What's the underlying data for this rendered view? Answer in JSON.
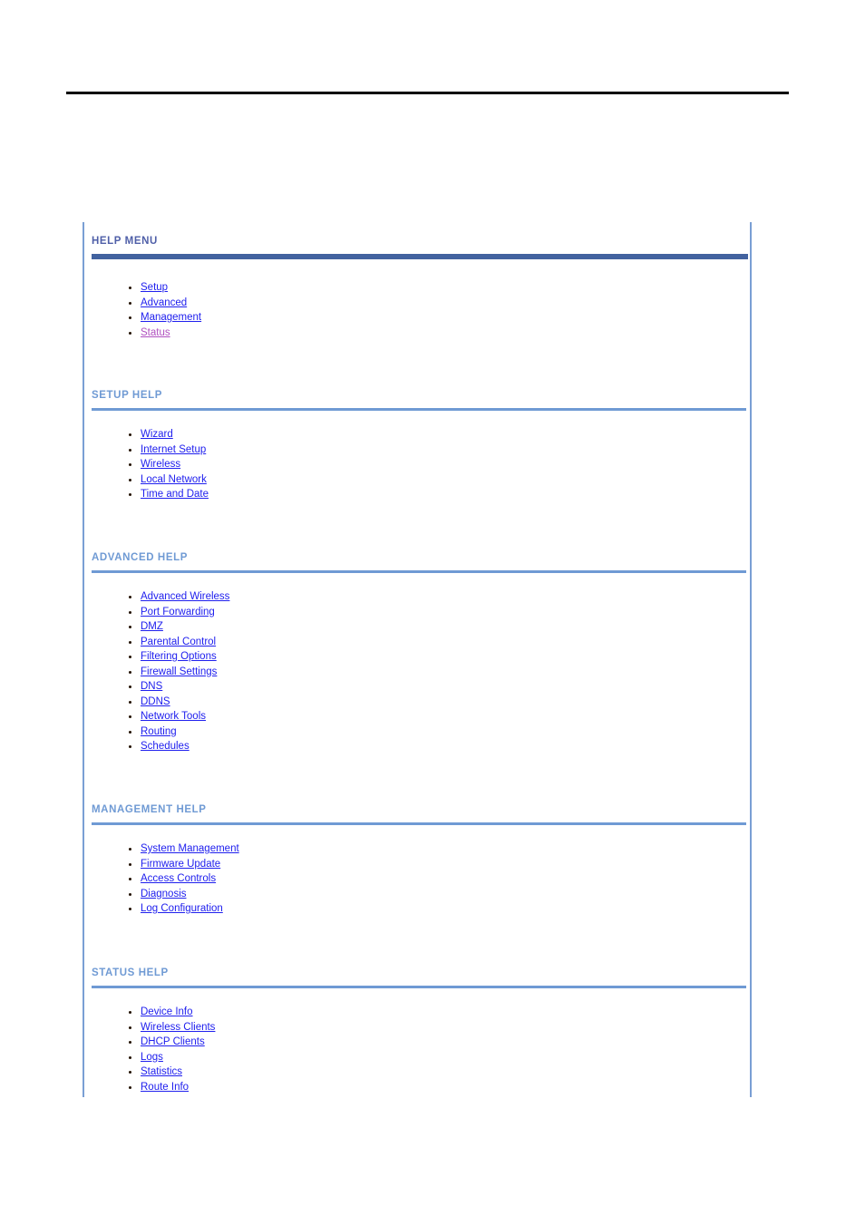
{
  "page": {
    "background": "#ffffff",
    "rule_color": "#000000",
    "frame_border_color": "#7a9fd4"
  },
  "colors": {
    "heading_primary": "#4f5fa8",
    "heading_regular": "#6f9ad4",
    "bar_primary": "#42629f",
    "bar_regular": "#6f9ad4",
    "link": "#2020ee",
    "link_visited": "#b050c0",
    "bullet": "#221100"
  },
  "sections": [
    {
      "id": "help-menu",
      "title": "HELP MENU",
      "style": "primary",
      "items": [
        {
          "label": "Setup",
          "visited": false
        },
        {
          "label": "Advanced",
          "visited": false
        },
        {
          "label": "Management",
          "visited": false
        },
        {
          "label": "Status",
          "visited": true
        }
      ]
    },
    {
      "id": "setup-help",
      "title": "SETUP HELP",
      "style": "regular",
      "items": [
        {
          "label": "Wizard",
          "visited": false
        },
        {
          "label": "Internet Setup",
          "visited": false
        },
        {
          "label": "Wireless",
          "visited": false
        },
        {
          "label": "Local Network",
          "visited": false
        },
        {
          "label": "Time and Date",
          "visited": false
        }
      ]
    },
    {
      "id": "advanced-help",
      "title": "ADVANCED HELP",
      "style": "regular",
      "items": [
        {
          "label": "Advanced Wireless",
          "visited": false
        },
        {
          "label": "Port Forwarding",
          "visited": false
        },
        {
          "label": "DMZ",
          "visited": false
        },
        {
          "label": "Parental Control",
          "visited": false
        },
        {
          "label": "Filtering Options",
          "visited": false
        },
        {
          "label": "Firewall Settings",
          "visited": false
        },
        {
          "label": "DNS",
          "visited": false
        },
        {
          "label": "DDNS",
          "visited": false
        },
        {
          "label": "Network Tools",
          "visited": false
        },
        {
          "label": "Routing",
          "visited": false
        },
        {
          "label": "Schedules",
          "visited": false
        }
      ]
    },
    {
      "id": "management-help",
      "title": "MANAGEMENT HELP",
      "style": "regular",
      "items": [
        {
          "label": "System Management",
          "visited": false
        },
        {
          "label": "Firmware Update",
          "visited": false
        },
        {
          "label": "Access Controls",
          "visited": false
        },
        {
          "label": "Diagnosis",
          "visited": false
        },
        {
          "label": "Log Configuration",
          "visited": false
        }
      ]
    },
    {
      "id": "status-help",
      "title": "STATUS HELP",
      "style": "regular",
      "items": [
        {
          "label": "Device Info",
          "visited": false
        },
        {
          "label": "Wireless Clients",
          "visited": false
        },
        {
          "label": "DHCP Clients",
          "visited": false
        },
        {
          "label": "Logs",
          "visited": false
        },
        {
          "label": "Statistics",
          "visited": false
        },
        {
          "label": "Route Info",
          "visited": false
        }
      ]
    }
  ],
  "layout": {
    "section_tops": [
      14,
      184,
      363,
      641,
      821
    ],
    "list_offsets": [
      50,
      42,
      42,
      42,
      42
    ]
  }
}
